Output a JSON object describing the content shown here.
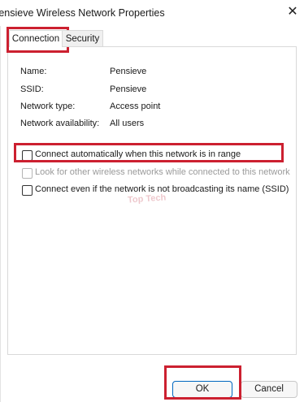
{
  "window": {
    "title": "Pensieve Wireless Network Properties",
    "close_glyph": "✕"
  },
  "tabs": [
    {
      "label": "Connection",
      "selected": true
    },
    {
      "label": "Security",
      "selected": false
    }
  ],
  "info": [
    {
      "label": "Name:",
      "value": "Pensieve"
    },
    {
      "label": "SSID:",
      "value": "Pensieve"
    },
    {
      "label": "Network type:",
      "value": "Access point"
    },
    {
      "label": "Network availability:",
      "value": "All users"
    }
  ],
  "options": [
    {
      "label": "Connect automatically when this network is in range",
      "checked": false,
      "enabled": true
    },
    {
      "label": "Look for other wireless networks while connected to this network",
      "checked": false,
      "enabled": false
    },
    {
      "label": "Connect even if the network is not broadcasting its name (SSID)",
      "checked": false,
      "enabled": true
    }
  ],
  "watermark": {
    "text": "Top Tech"
  },
  "buttons": {
    "ok": "OK",
    "cancel": "Cancel"
  },
  "colors": {
    "highlight": "#cc2030",
    "ok_border": "#0067c0",
    "panel_border": "#d9d9d9"
  }
}
